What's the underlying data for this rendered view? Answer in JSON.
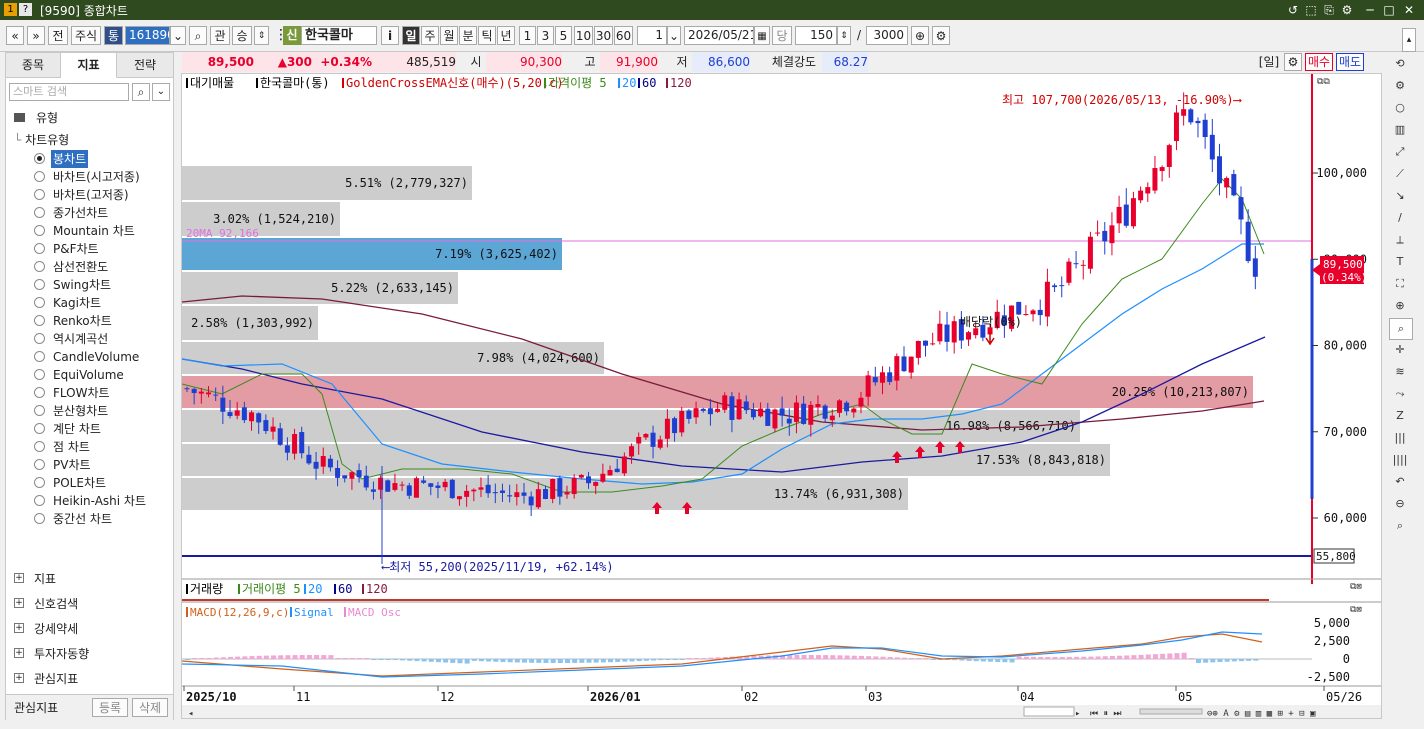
{
  "window": {
    "title": "[9590] 종합차트",
    "controls": [
      "↺",
      "⬚",
      "⎘",
      "⚙",
      "─",
      "□",
      "✕"
    ]
  },
  "toolbar": {
    "nav_prev": "«",
    "nav_down": "»",
    "btn_prev": "전",
    "market": "주식",
    "market_type": "통",
    "code": "161890",
    "btn_gwan": "관",
    "btn_sung": "승",
    "stock_badge": "신",
    "stock_name": "한국콜마",
    "btn_info": "i",
    "periods": [
      "일",
      "주",
      "월",
      "분",
      "틱",
      "년"
    ],
    "period_active": "일",
    "intervals": [
      "1",
      "3",
      "5",
      "10",
      "30",
      "60"
    ],
    "interval_value": "1",
    "date": "2026/05/21",
    "btn_dang": "당",
    "count": "150",
    "slash": "/",
    "max_count": "3000"
  },
  "left_panel": {
    "tabs": [
      "종목",
      "지표",
      "전략"
    ],
    "active_tab": "지표",
    "search_placeholder": "스마트 검색",
    "section_title": "유형",
    "group_title": "차트유형",
    "chart_types": [
      "봉차트",
      "바차트(시고저종)",
      "바차트(고저종)",
      "종가선차트",
      "Mountain 차트",
      "P&F차트",
      "삼선전환도",
      "Swing차트",
      "Kagi차트",
      "Renko차트",
      "역시계곡선",
      "CandleVolume",
      "EquiVolume",
      "FLOW차트",
      "분산형차트",
      "계단 차트",
      "점 차트",
      "PV차트",
      "POLE차트",
      "Heikin-Ashi 차트",
      "중간선 차트"
    ],
    "selected_type": "봉차트",
    "categories": [
      "지표",
      "신호검색",
      "강세약세",
      "투자자동향",
      "관심지표"
    ],
    "footer_label": "관심지표",
    "btn_register": "등록",
    "btn_delete": "삭제"
  },
  "price_bar": {
    "price": "89,500",
    "change": "▲300",
    "change_pct": "+0.34%",
    "volume": "485,519",
    "open_label": "시",
    "open": "90,300",
    "high_label": "고",
    "high": "91,900",
    "low_label": "저",
    "low": "86,600",
    "strength_label": "체결강도",
    "strength": "68.27",
    "period_tag": "[일]",
    "buy": "매수",
    "sell": "매도"
  },
  "chart": {
    "legend": {
      "items": [
        "대기매물",
        "한국콜마(통)",
        "GoldenCrossEMA신호(매수)(5,20,c)",
        "가격이평 5",
        "20",
        "60",
        "120"
      ],
      "colors": [
        "#000000",
        "#000000",
        "#d00000",
        "#3a8a1a",
        "#1e90ff",
        "#00008b",
        "#8b1a3a"
      ]
    },
    "y_ticks": [
      "100,000",
      "90,000",
      "80,000",
      "70,000",
      "60,000"
    ],
    "y_ticks_values": [
      100000,
      90000,
      80000,
      70000,
      60000
    ],
    "current_label": "89,500",
    "current_pct": "(0.34%)",
    "low_line_label": "55,800",
    "annotations": {
      "high": "최고 107,700(2026/05/13, -16.90%)⟶",
      "low": "⟵최저 55,200(2025/11/19, +62.14%)",
      "dividend": "배당락(0%)",
      "ema": "20MA 92,166"
    },
    "volume_profile": [
      {
        "label": "5.51% (2,779,327)",
        "pct": 5.51
      },
      {
        "label": "3.02% (1,524,210)",
        "pct": 3.02
      },
      {
        "label": "7.19% (3,625,402)",
        "pct": 7.19
      },
      {
        "label": "5.22% (2,633,145)",
        "pct": 5.22
      },
      {
        "label": "2.58% (1,303,992)",
        "pct": 2.58
      },
      {
        "label": "7.98% (4,024,600)",
        "pct": 7.98
      },
      {
        "label": "20.25% (10,213,807)",
        "pct": 20.25
      },
      {
        "label": "16.98% (8,566,710)",
        "pct": 16.98
      },
      {
        "label": "17.53% (8,843,818)",
        "pct": 17.53
      },
      {
        "label": "13.74% (6,931,308)",
        "pct": 13.74
      }
    ],
    "x_ticks": [
      "2025/10",
      "11",
      "12",
      "2026/01",
      "02",
      "03",
      "04",
      "05",
      "05/26"
    ],
    "volume_legend": [
      "거래량",
      "거래이평 5",
      "20",
      "60",
      "120"
    ],
    "macd_legend": [
      "MACD(12,26,9,c)",
      "Signal",
      "MACD Osc"
    ],
    "macd_ticks": [
      "5,000",
      "2,500",
      "0",
      "-2,500"
    ],
    "colors": {
      "up": "#e8002d",
      "down": "#1f3fd0",
      "ma5": "#3a8a1a",
      "ma20": "#1e90ff",
      "ma60": "#1a1aa0",
      "ma120": "#7a1a3a",
      "profile_gray": "#c8c8c8",
      "profile_red": "#e0909a",
      "profile_blue": "#4a9cd0"
    }
  },
  "chart_data": {
    "type": "candlestick",
    "title": "한국콜마(통)",
    "ylim": [
      53000,
      110000
    ],
    "x": [
      "2025/10",
      "11",
      "12",
      "2026/01",
      "02",
      "03",
      "04",
      "05",
      "05/26"
    ],
    "series": [
      {
        "name": "한국콜마(통)",
        "values": [
          75000,
          72000,
          66000,
          64000,
          63500,
          62500,
          64000,
          69500,
          73000,
          72000,
          74000,
          80000,
          83000,
          86000,
          95000,
          107700,
          89500
        ]
      }
    ]
  }
}
